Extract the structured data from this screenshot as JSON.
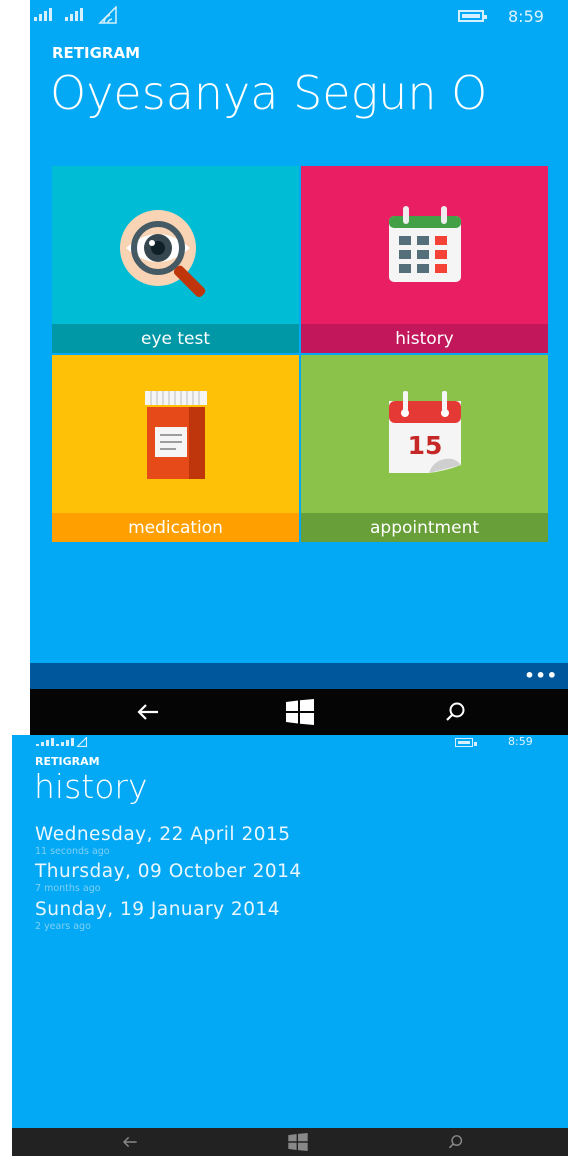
{
  "screen_home": {
    "status": {
      "sim1": "1",
      "sim2": "2",
      "time": "8:59"
    },
    "app_name": "RETIGRAM",
    "user_name": "Oyesanya Segun O",
    "tiles": [
      {
        "label": "eye test",
        "icon": "eye-magnifier-icon",
        "color": "#00bcd4",
        "label_bg": "#0097a7"
      },
      {
        "label": "history",
        "icon": "calendar-grid-icon",
        "color": "#e91e63",
        "label_bg": "#c2185b"
      },
      {
        "label": "medication",
        "icon": "pill-bottle-icon",
        "color": "#ffc107",
        "label_bg": "#ffa000"
      },
      {
        "label": "appointment",
        "icon": "calendar-15-icon",
        "color": "#8bc34a",
        "label_bg": "#689f38"
      }
    ],
    "appointment_day": "15",
    "more": "•••"
  },
  "screen_history": {
    "status": {
      "time": "8:59"
    },
    "app_name": "RETIGRAM",
    "page_title": "history",
    "entries": [
      {
        "date": "Wednesday, 22 April 2015",
        "ago": "11 seconds ago"
      },
      {
        "date": "Thursday, 09 October 2014",
        "ago": "7 months ago"
      },
      {
        "date": "Sunday, 19 January 2014",
        "ago": "2 years ago"
      }
    ]
  },
  "colors": {
    "background": "#03a9f4",
    "appbar": "#01579b",
    "navbar": "#050505"
  }
}
